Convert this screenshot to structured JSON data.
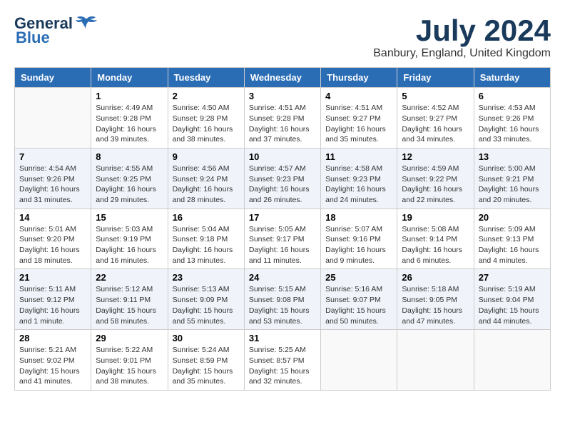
{
  "header": {
    "logo_line1": "General",
    "logo_line2": "Blue",
    "month_year": "July 2024",
    "location": "Banbury, England, United Kingdom"
  },
  "weekdays": [
    "Sunday",
    "Monday",
    "Tuesday",
    "Wednesday",
    "Thursday",
    "Friday",
    "Saturday"
  ],
  "weeks": [
    [
      {
        "day": "",
        "info": ""
      },
      {
        "day": "1",
        "info": "Sunrise: 4:49 AM\nSunset: 9:28 PM\nDaylight: 16 hours\nand 39 minutes."
      },
      {
        "day": "2",
        "info": "Sunrise: 4:50 AM\nSunset: 9:28 PM\nDaylight: 16 hours\nand 38 minutes."
      },
      {
        "day": "3",
        "info": "Sunrise: 4:51 AM\nSunset: 9:28 PM\nDaylight: 16 hours\nand 37 minutes."
      },
      {
        "day": "4",
        "info": "Sunrise: 4:51 AM\nSunset: 9:27 PM\nDaylight: 16 hours\nand 35 minutes."
      },
      {
        "day": "5",
        "info": "Sunrise: 4:52 AM\nSunset: 9:27 PM\nDaylight: 16 hours\nand 34 minutes."
      },
      {
        "day": "6",
        "info": "Sunrise: 4:53 AM\nSunset: 9:26 PM\nDaylight: 16 hours\nand 33 minutes."
      }
    ],
    [
      {
        "day": "7",
        "info": "Sunrise: 4:54 AM\nSunset: 9:26 PM\nDaylight: 16 hours\nand 31 minutes."
      },
      {
        "day": "8",
        "info": "Sunrise: 4:55 AM\nSunset: 9:25 PM\nDaylight: 16 hours\nand 29 minutes."
      },
      {
        "day": "9",
        "info": "Sunrise: 4:56 AM\nSunset: 9:24 PM\nDaylight: 16 hours\nand 28 minutes."
      },
      {
        "day": "10",
        "info": "Sunrise: 4:57 AM\nSunset: 9:23 PM\nDaylight: 16 hours\nand 26 minutes."
      },
      {
        "day": "11",
        "info": "Sunrise: 4:58 AM\nSunset: 9:23 PM\nDaylight: 16 hours\nand 24 minutes."
      },
      {
        "day": "12",
        "info": "Sunrise: 4:59 AM\nSunset: 9:22 PM\nDaylight: 16 hours\nand 22 minutes."
      },
      {
        "day": "13",
        "info": "Sunrise: 5:00 AM\nSunset: 9:21 PM\nDaylight: 16 hours\nand 20 minutes."
      }
    ],
    [
      {
        "day": "14",
        "info": "Sunrise: 5:01 AM\nSunset: 9:20 PM\nDaylight: 16 hours\nand 18 minutes."
      },
      {
        "day": "15",
        "info": "Sunrise: 5:03 AM\nSunset: 9:19 PM\nDaylight: 16 hours\nand 16 minutes."
      },
      {
        "day": "16",
        "info": "Sunrise: 5:04 AM\nSunset: 9:18 PM\nDaylight: 16 hours\nand 13 minutes."
      },
      {
        "day": "17",
        "info": "Sunrise: 5:05 AM\nSunset: 9:17 PM\nDaylight: 16 hours\nand 11 minutes."
      },
      {
        "day": "18",
        "info": "Sunrise: 5:07 AM\nSunset: 9:16 PM\nDaylight: 16 hours\nand 9 minutes."
      },
      {
        "day": "19",
        "info": "Sunrise: 5:08 AM\nSunset: 9:14 PM\nDaylight: 16 hours\nand 6 minutes."
      },
      {
        "day": "20",
        "info": "Sunrise: 5:09 AM\nSunset: 9:13 PM\nDaylight: 16 hours\nand 4 minutes."
      }
    ],
    [
      {
        "day": "21",
        "info": "Sunrise: 5:11 AM\nSunset: 9:12 PM\nDaylight: 16 hours\nand 1 minute."
      },
      {
        "day": "22",
        "info": "Sunrise: 5:12 AM\nSunset: 9:11 PM\nDaylight: 15 hours\nand 58 minutes."
      },
      {
        "day": "23",
        "info": "Sunrise: 5:13 AM\nSunset: 9:09 PM\nDaylight: 15 hours\nand 55 minutes."
      },
      {
        "day": "24",
        "info": "Sunrise: 5:15 AM\nSunset: 9:08 PM\nDaylight: 15 hours\nand 53 minutes."
      },
      {
        "day": "25",
        "info": "Sunrise: 5:16 AM\nSunset: 9:07 PM\nDaylight: 15 hours\nand 50 minutes."
      },
      {
        "day": "26",
        "info": "Sunrise: 5:18 AM\nSunset: 9:05 PM\nDaylight: 15 hours\nand 47 minutes."
      },
      {
        "day": "27",
        "info": "Sunrise: 5:19 AM\nSunset: 9:04 PM\nDaylight: 15 hours\nand 44 minutes."
      }
    ],
    [
      {
        "day": "28",
        "info": "Sunrise: 5:21 AM\nSunset: 9:02 PM\nDaylight: 15 hours\nand 41 minutes."
      },
      {
        "day": "29",
        "info": "Sunrise: 5:22 AM\nSunset: 9:01 PM\nDaylight: 15 hours\nand 38 minutes."
      },
      {
        "day": "30",
        "info": "Sunrise: 5:24 AM\nSunset: 8:59 PM\nDaylight: 15 hours\nand 35 minutes."
      },
      {
        "day": "31",
        "info": "Sunrise: 5:25 AM\nSunset: 8:57 PM\nDaylight: 15 hours\nand 32 minutes."
      },
      {
        "day": "",
        "info": ""
      },
      {
        "day": "",
        "info": ""
      },
      {
        "day": "",
        "info": ""
      }
    ]
  ]
}
